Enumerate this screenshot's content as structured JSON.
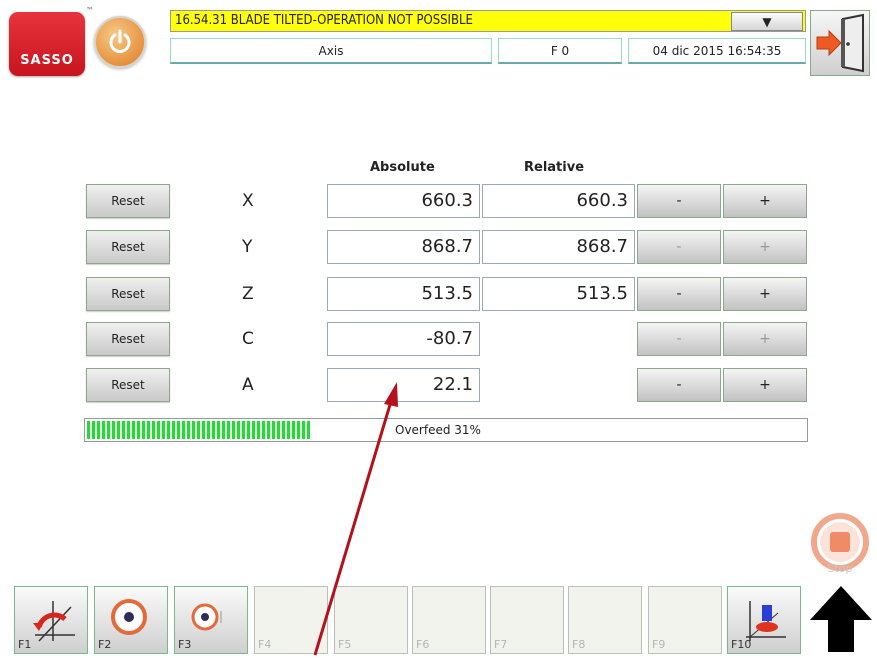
{
  "header": {
    "logo_text": "SASSO",
    "logo_mark": "™",
    "alarm_text": "16.54.31 BLADE TILTED-OPERATION NOT POSSIBLE",
    "alarm_dropdown": "▼",
    "mode": "Axis",
    "function": "F 0",
    "datetime": "04 dic 2015 16:54:35"
  },
  "table": {
    "col_absolute": "Absolute",
    "col_relative": "Relative",
    "reset_label": "Reset",
    "minus_label": "-",
    "plus_label": "+",
    "rows": [
      {
        "axis": "X",
        "absolute": "660.3",
        "relative": "660.3"
      },
      {
        "axis": "Y",
        "absolute": "868.7",
        "relative": "868.7"
      },
      {
        "axis": "Z",
        "absolute": "513.5",
        "relative": "513.5"
      },
      {
        "axis": "C",
        "absolute": "-80.7",
        "relative": ""
      },
      {
        "axis": "A",
        "absolute": "22.1",
        "relative": ""
      }
    ]
  },
  "overfeed": {
    "label": "Overfeed 31%",
    "fraction": 0.31
  },
  "stop_label": "Stop",
  "fkeys": [
    {
      "label": "F1",
      "enabled": true,
      "icon": "blade-tilt-icon"
    },
    {
      "label": "F2",
      "enabled": true,
      "icon": "disc-icon"
    },
    {
      "label": "F3",
      "enabled": true,
      "icon": "disc-small-icon"
    },
    {
      "label": "F4",
      "enabled": false
    },
    {
      "label": "F5",
      "enabled": false
    },
    {
      "label": "F6",
      "enabled": false
    },
    {
      "label": "F7",
      "enabled": false
    },
    {
      "label": "F8",
      "enabled": false
    },
    {
      "label": "F9",
      "enabled": false
    },
    {
      "label": "F10",
      "enabled": true,
      "icon": "tool-axis-icon"
    }
  ],
  "colors": {
    "alarm_bg": "#ffff0a",
    "logo": "#d41f27",
    "progress": "#2ad63a",
    "annotation_arrow": "#b3121a",
    "stop": "#e8623c"
  }
}
